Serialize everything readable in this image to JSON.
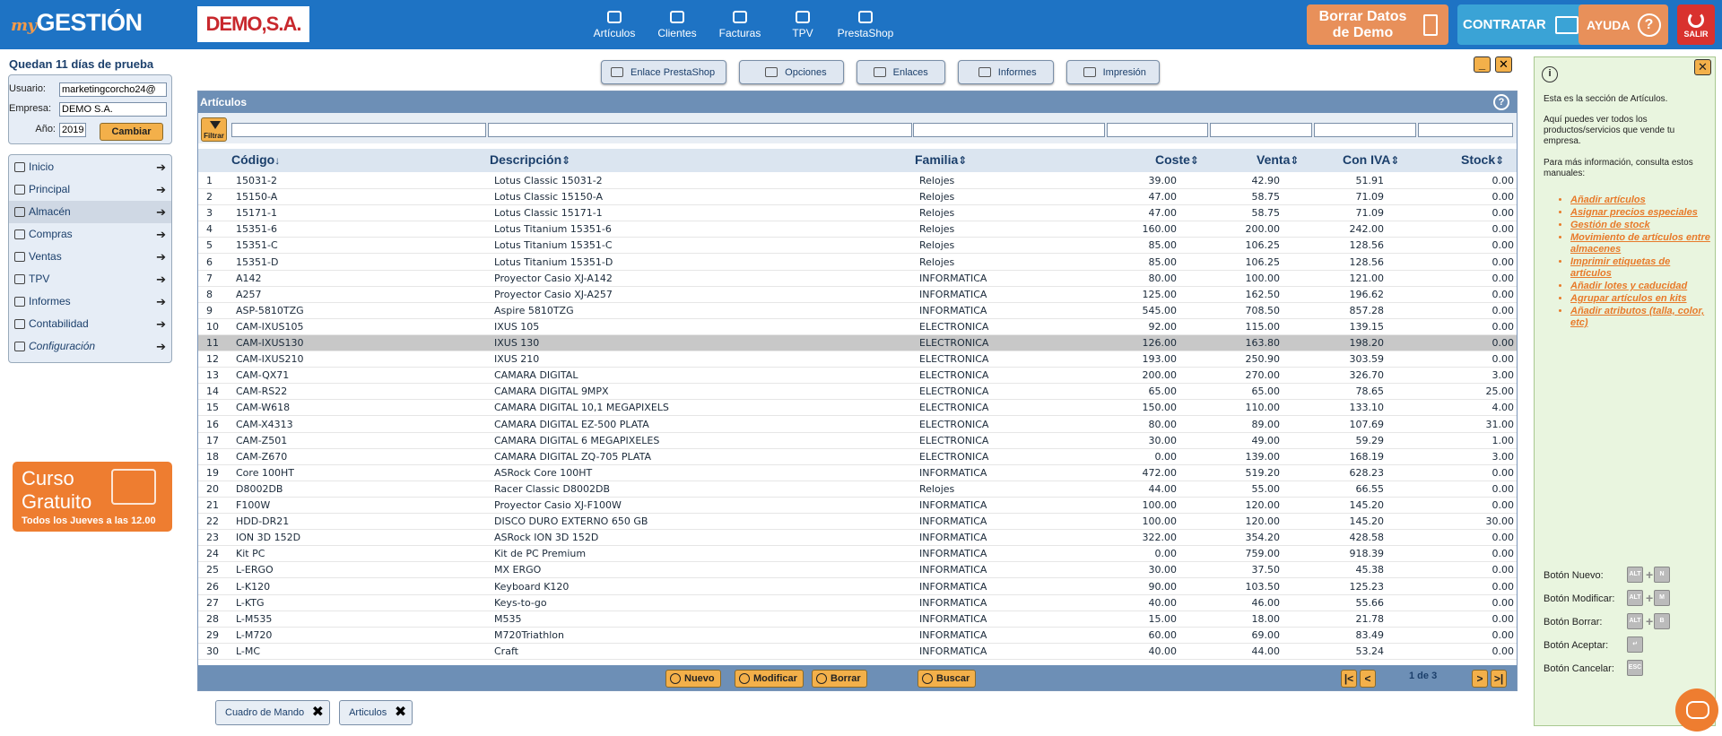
{
  "brand": {
    "my": "my",
    "name": "GESTIÓN",
    "company_logo": "DEMO,S.A."
  },
  "topnav": [
    {
      "label": "Artículos",
      "icon": "articles-icon"
    },
    {
      "label": "Clientes",
      "icon": "clients-icon"
    },
    {
      "label": "Facturas",
      "icon": "invoices-icon"
    },
    {
      "label": "TPV",
      "icon": "pos-icon"
    },
    {
      "label": "PrestaShop",
      "icon": "prestashop-icon"
    }
  ],
  "topbuttons": {
    "borrar_line1": "Borrar Datos",
    "borrar_line2": "de Demo",
    "contratar": "CONTRATAR",
    "ayuda": "AYUDA",
    "ayuda_icon": "?",
    "salir": "SALIR"
  },
  "sidebar": {
    "trial": "Quedan 11 días de prueba",
    "usuario_label": "Usuario:",
    "usuario_value": "marketingcorcho24@",
    "empresa_label": "Empresa:",
    "empresa_value": "DEMO S.A.",
    "anio_label": "Año:",
    "anio_value": "2019",
    "cambiar": "Cambiar",
    "menu": [
      {
        "label": "Inicio",
        "arrow": "➔"
      },
      {
        "label": "Principal",
        "arrow": "➔"
      },
      {
        "label": "Almacén",
        "arrow": "➔"
      },
      {
        "label": "Compras",
        "arrow": "➔"
      },
      {
        "label": "Ventas",
        "arrow": "➔"
      },
      {
        "label": "TPV",
        "arrow": "➔"
      },
      {
        "label": "Informes",
        "arrow": "➔"
      },
      {
        "label": "Contabilidad",
        "arrow": "➔"
      },
      {
        "label": "Configuración",
        "arrow": "➔"
      }
    ],
    "promo_line1": "Curso",
    "promo_line2": "Gratuito",
    "promo_line3": "Todos los Jueves a las 12.00"
  },
  "toolbar": [
    "Enlace PrestaShop",
    "Opciones",
    "Enlaces",
    "Informes",
    "Impresión"
  ],
  "window_controls": {
    "minimize": "_",
    "close": "✕"
  },
  "panel": {
    "title": "Artículos",
    "help": "?",
    "filter_label": "Filtrar",
    "columns": [
      "Código",
      "Descripción",
      "Familia",
      "Coste",
      "Venta",
      "Con IVA",
      "Stock"
    ],
    "sort_icons": {
      "codigo": "↓",
      "other": "⇕"
    },
    "rows": [
      [
        "1",
        "15031-2",
        "Lotus Classic 15031-2",
        "Relojes",
        "39.00",
        "42.90",
        "51.91",
        "0.00"
      ],
      [
        "2",
        "15150-A",
        "Lotus Classic 15150-A",
        "Relojes",
        "47.00",
        "58.75",
        "71.09",
        "0.00"
      ],
      [
        "3",
        "15171-1",
        "Lotus Classic 15171-1",
        "Relojes",
        "47.00",
        "58.75",
        "71.09",
        "0.00"
      ],
      [
        "4",
        "15351-6",
        "Lotus Titanium 15351-6",
        "Relojes",
        "160.00",
        "200.00",
        "242.00",
        "0.00"
      ],
      [
        "5",
        "15351-C",
        "Lotus Titanium 15351-C",
        "Relojes",
        "85.00",
        "106.25",
        "128.56",
        "0.00"
      ],
      [
        "6",
        "15351-D",
        "Lotus Titanium 15351-D",
        "Relojes",
        "85.00",
        "106.25",
        "128.56",
        "0.00"
      ],
      [
        "7",
        "A142",
        "Proyector Casio XJ-A142",
        "INFORMATICA",
        "80.00",
        "100.00",
        "121.00",
        "0.00"
      ],
      [
        "8",
        "A257",
        "Proyector Casio XJ-A257",
        "INFORMATICA",
        "125.00",
        "162.50",
        "196.62",
        "0.00"
      ],
      [
        "9",
        "ASP-5810TZG",
        "Aspire 5810TZG",
        "INFORMATICA",
        "545.00",
        "708.50",
        "857.28",
        "0.00"
      ],
      [
        "10",
        "CAM-IXUS105",
        "IXUS 105",
        "ELECTRONICA",
        "92.00",
        "115.00",
        "139.15",
        "0.00"
      ],
      [
        "11",
        "CAM-IXUS130",
        "IXUS 130",
        "ELECTRONICA",
        "126.00",
        "163.80",
        "198.20",
        "0.00"
      ],
      [
        "12",
        "CAM-IXUS210",
        "IXUS 210",
        "ELECTRONICA",
        "193.00",
        "250.90",
        "303.59",
        "0.00"
      ],
      [
        "13",
        "CAM-QX71",
        "CAMARA DIGITAL",
        "ELECTRONICA",
        "200.00",
        "270.00",
        "326.70",
        "3.00"
      ],
      [
        "14",
        "CAM-RS22",
        "CAMARA DIGITAL 9MPX",
        "ELECTRONICA",
        "65.00",
        "65.00",
        "78.65",
        "25.00"
      ],
      [
        "15",
        "CAM-W618",
        "CAMARA DIGITAL 10,1 MEGAPIXELS",
        "ELECTRONICA",
        "150.00",
        "110.00",
        "133.10",
        "4.00"
      ],
      [
        "16",
        "CAM-X4313",
        "CAMARA DIGITAL EZ-500 PLATA",
        "ELECTRONICA",
        "80.00",
        "89.00",
        "107.69",
        "31.00"
      ],
      [
        "17",
        "CAM-Z501",
        "CAMARA DIGITAL 6 MEGAPIXELES",
        "ELECTRONICA",
        "30.00",
        "49.00",
        "59.29",
        "1.00"
      ],
      [
        "18",
        "CAM-Z670",
        "CAMARA DIGITAL ZQ-705 PLATA",
        "ELECTRONICA",
        "0.00",
        "139.00",
        "168.19",
        "3.00"
      ],
      [
        "19",
        "Core 100HT",
        "ASRock Core 100HT",
        "INFORMATICA",
        "472.00",
        "519.20",
        "628.23",
        "0.00"
      ],
      [
        "20",
        "D8002DB",
        "Racer Classic D8002DB",
        "Relojes",
        "44.00",
        "55.00",
        "66.55",
        "0.00"
      ],
      [
        "21",
        "F100W",
        "Proyector Casio XJ-F100W",
        "INFORMATICA",
        "100.00",
        "120.00",
        "145.20",
        "0.00"
      ],
      [
        "22",
        "HDD-DR21",
        "DISCO DURO EXTERNO 650 GB",
        "INFORMATICA",
        "100.00",
        "120.00",
        "145.20",
        "30.00"
      ],
      [
        "23",
        "ION 3D 152D",
        "ASRock ION 3D 152D",
        "INFORMATICA",
        "322.00",
        "354.20",
        "428.58",
        "0.00"
      ],
      [
        "24",
        "Kit PC",
        "Kit de PC Premium",
        "INFORMATICA",
        "0.00",
        "759.00",
        "918.39",
        "0.00"
      ],
      [
        "25",
        "L-ERGO",
        "MX ERGO",
        "INFORMATICA",
        "30.00",
        "37.50",
        "45.38",
        "0.00"
      ],
      [
        "26",
        "L-K120",
        "Keyboard K120",
        "INFORMATICA",
        "90.00",
        "103.50",
        "125.23",
        "0.00"
      ],
      [
        "27",
        "L-KTG",
        "Keys-to-go",
        "INFORMATICA",
        "40.00",
        "46.00",
        "55.66",
        "0.00"
      ],
      [
        "28",
        "L-M535",
        "M535",
        "INFORMATICA",
        "15.00",
        "18.00",
        "21.78",
        "0.00"
      ],
      [
        "29",
        "L-M720",
        "M720Triathlon",
        "INFORMATICA",
        "60.00",
        "69.00",
        "83.49",
        "0.00"
      ],
      [
        "30",
        "L-MC",
        "Craft",
        "INFORMATICA",
        "40.00",
        "44.00",
        "53.24",
        "0.00"
      ]
    ],
    "selected_row": 11,
    "footer": {
      "nuevo": "Nuevo",
      "modificar": "Modificar",
      "borrar": "Borrar",
      "buscar": "Buscar",
      "page": "1 de 3",
      "first": "|<",
      "prev": "<",
      "next": ">",
      "last": ">|"
    }
  },
  "wintabs": [
    {
      "label": "Cuadro de Mando",
      "close": "✖"
    },
    {
      "label": "Articulos",
      "close": "✖"
    }
  ],
  "help": {
    "close": "✕",
    "info": "i",
    "intro": "Esta es la sección de Artículos.",
    "desc": "Aquí puedes ver todos los productos/servicios que vende tu empresa.",
    "more": "Para más información, consulta estos manuales:",
    "links": [
      "Añadir artículos",
      "Asignar precios especiales",
      "Gestión de stock",
      "Movimiento de artículos entre almacenes",
      "Imprimir etiquetas de artículos",
      "Añadir lotes y caducidad",
      "Agrupar artículos en kits",
      "Añadir atributos (talla, color, etc)"
    ],
    "shortcuts": [
      {
        "label": "Botón Nuevo:",
        "keys": [
          "ALT",
          "N"
        ]
      },
      {
        "label": "Botón Modificar:",
        "keys": [
          "ALT",
          "M"
        ]
      },
      {
        "label": "Botón Borrar:",
        "keys": [
          "ALT",
          "B"
        ]
      },
      {
        "label": "Botón Aceptar:",
        "keys": [
          "↵"
        ]
      },
      {
        "label": "Botón Cancelar:",
        "keys": [
          "ESC"
        ]
      }
    ]
  },
  "colors": {
    "topbar": "#1e73c4",
    "accent": "#f3b04a",
    "orange": "#e8905a",
    "panel_head": "#6d8fb6"
  }
}
